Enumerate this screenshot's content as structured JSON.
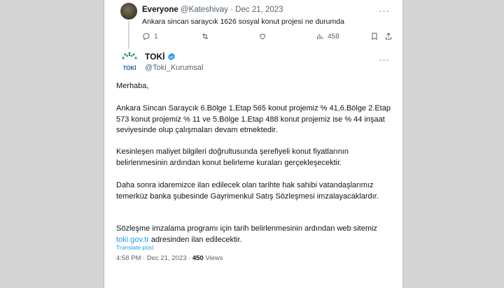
{
  "reply": {
    "name": "Everyone",
    "handle": "@Kateshivay",
    "sep": "·",
    "date": "Dec 21, 2023",
    "text": "Ankara sincan saraycık 1626 sosyal konut projesi ne durumda",
    "reply_count": "1",
    "views": "458"
  },
  "tweet": {
    "name": "TOKİ",
    "handle": "@Toki_Kurumsal",
    "greeting": "Merhaba,",
    "para1": "Ankara Sincan Saraycık 6.Bölge 1.Etap 565 konut projemiz % 41,6.Bölge 2.Etap 573 konut projemiz % 11 ve 5.Bölge 1.Etap 488 konut projemiz ise % 44 inşaat seviyesinde olup çalışmaları devam etmektedir.",
    "para2": "Kesinleşen maliyet bilgileri doğrultusunda şerefiyeli konut fiyatlarının belirlenmesinin ardından konut belirleme kuraları gerçekleşecektir.",
    "para3": "Daha sonra idaremizce ilan edilecek olan tarihte hak sahibi vatandaşlarımız temerküz banka şubesinde Gayrimenkul Satış Sözleşmesi imzalayacaklardır.",
    "para4_before": "Sözleşme imzalama programı için tarih belirlenmesinin ardından web sitemiz ",
    "para4_link": "toki.gov.tr",
    "para4_after": " adresinden ilan edilecektir.",
    "translate": "Translate post",
    "time": "4:58 PM",
    "sep": "·",
    "date": "Dec 21, 2023",
    "views_count": "450",
    "views_label": "Views"
  },
  "colors": {
    "accent": "#1d9bf0",
    "verified": "#1d9bf0",
    "secondary_text": "#536471"
  },
  "icons": [
    "reply-icon",
    "retweet-icon",
    "like-icon",
    "views-icon",
    "bookmark-icon",
    "share-icon",
    "more-icon",
    "verified-icon"
  ]
}
